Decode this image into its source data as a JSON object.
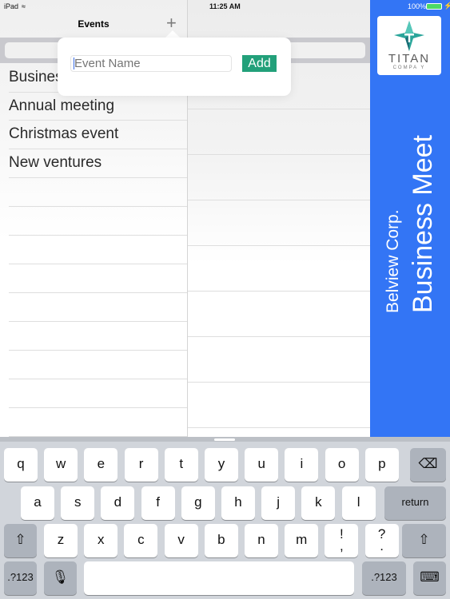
{
  "status_bar": {
    "device": "iPad",
    "time": "11:25 AM",
    "battery": "100%"
  },
  "events_panel": {
    "title": "Events",
    "add_icon": "plus-icon",
    "items": [
      "Business Meet",
      "Annual meeting",
      "Christmas event",
      "New ventures"
    ]
  },
  "popover": {
    "input_placeholder": "Event Name",
    "input_value": "",
    "add_label": "Add"
  },
  "brand_panel": {
    "logo_name": "TITAN",
    "logo_sub": "COMPA Y",
    "company": "Belview Corp.",
    "event_title": "Business Meet",
    "color": "#3375f5"
  },
  "keyboard": {
    "row1": [
      "q",
      "w",
      "e",
      "r",
      "t",
      "y",
      "u",
      "i",
      "o",
      "p"
    ],
    "row2": [
      "a",
      "s",
      "d",
      "f",
      "g",
      "h",
      "j",
      "k",
      "l"
    ],
    "row3": [
      "z",
      "x",
      "c",
      "v",
      "b",
      "n",
      "m",
      "!\n,",
      "?\n."
    ],
    "return_label": "return",
    "numbers_label": ".?123",
    "add_color": "#22a07a"
  }
}
